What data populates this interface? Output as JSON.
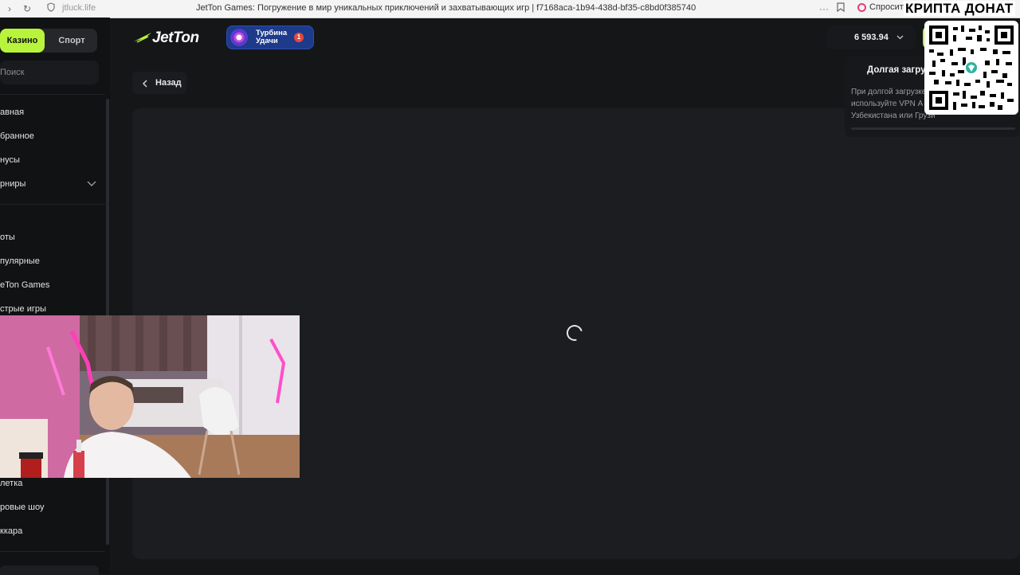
{
  "browser": {
    "url": "jtluck.life",
    "page_title": "JetTon Games: Погружение в мир уникальных приключений и захватывающих игр | f7168aca-1b94-438d-bf35-c8bd0f385740",
    "ask_label": "Спросит"
  },
  "sidebar": {
    "tabs": {
      "casino": "Казино",
      "sport": "Спорт"
    },
    "search_placeholder": "Поиск",
    "items": [
      "авная",
      "бранное",
      "нусы",
      "рниры"
    ],
    "items2": [
      "оты",
      "пулярные",
      "eTon Games",
      "стрые игры"
    ],
    "items3": [
      "летка",
      "ровые шоу",
      "ккара"
    ]
  },
  "header": {
    "logo_text": "JetTon",
    "promo": {
      "line1": "Турбина",
      "line2": "Удачи",
      "badge": "1"
    },
    "balance": "6 593.94"
  },
  "back_label": "Назад",
  "notice": {
    "title": "Долгая загру",
    "body": "При долгой загрузке используйте VPN А Узбекистана или Грузи"
  },
  "overlay": {
    "donat_text": "КРИПТА ДОНАТ"
  },
  "colors": {
    "accent": "#b7f43b",
    "promo_bg": "#1e3a8a",
    "background": "#151618"
  }
}
